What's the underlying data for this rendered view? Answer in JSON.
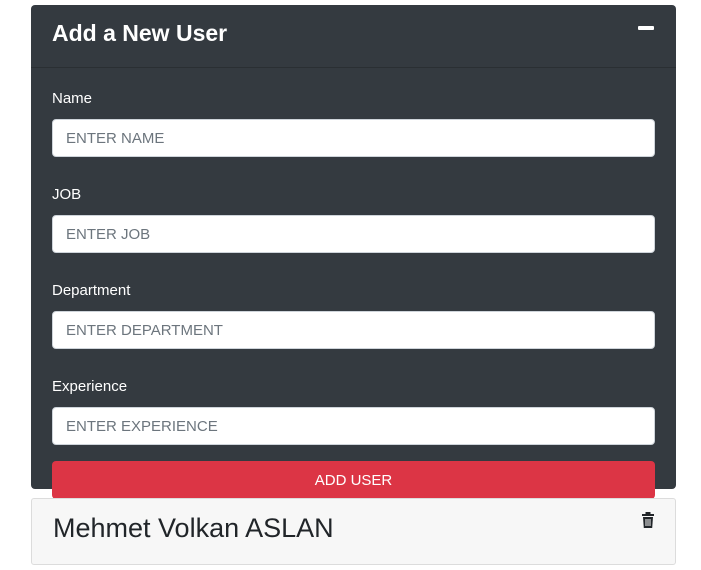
{
  "form_card": {
    "title": "Add a New User",
    "collapse_icon": "minus-icon",
    "fields": [
      {
        "label": "Name",
        "placeholder": "ENTER NAME",
        "value": ""
      },
      {
        "label": "JOB",
        "placeholder": "ENTER JOB",
        "value": ""
      },
      {
        "label": "Department",
        "placeholder": "ENTER DEPARTMENT",
        "value": ""
      },
      {
        "label": "Experience",
        "placeholder": "ENTER EXPERIENCE",
        "value": ""
      }
    ],
    "submit_label": "ADD USER"
  },
  "users": [
    {
      "name": "Mehmet Volkan ASLAN",
      "delete_icon": "trash-icon"
    }
  ],
  "colors": {
    "card_background": "#343a40",
    "submit_button": "#dc3545",
    "user_card_background": "#f7f7f7"
  }
}
